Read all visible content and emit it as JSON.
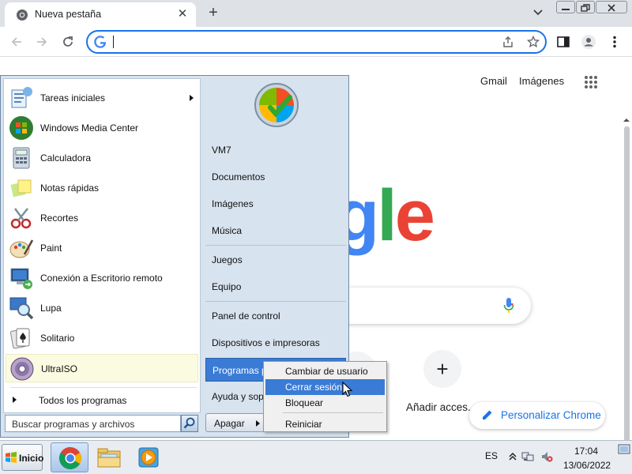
{
  "browser": {
    "tab_title": "Nueva pestaña",
    "tab_close": "✕",
    "new_tab": "+",
    "address_value": ""
  },
  "page": {
    "links": [
      "Gmail",
      "Imágenes"
    ],
    "logo_fragment": [
      "g",
      "l",
      "e"
    ],
    "shortcut_add_symbol": "+",
    "shortcut_add_label": "Añadir acces...",
    "customize_label": "Personalizar Chrome"
  },
  "start_menu": {
    "programs": [
      {
        "label": "Tareas iniciales",
        "icon": "getting-started-icon",
        "submenu": true
      },
      {
        "label": "Windows Media Center",
        "icon": "media-center-icon",
        "submenu": false
      },
      {
        "label": "Calculadora",
        "icon": "calculator-icon",
        "submenu": false
      },
      {
        "label": "Notas rápidas",
        "icon": "sticky-notes-icon",
        "submenu": false
      },
      {
        "label": "Recortes",
        "icon": "snipping-tool-icon",
        "submenu": false
      },
      {
        "label": "Paint",
        "icon": "paint-icon",
        "submenu": false
      },
      {
        "label": "Conexión a Escritorio remoto",
        "icon": "remote-desktop-icon",
        "submenu": false
      },
      {
        "label": "Lupa",
        "icon": "magnifier-icon",
        "submenu": false
      },
      {
        "label": "Solitario",
        "icon": "solitaire-icon",
        "submenu": false
      },
      {
        "label": "UltraISO",
        "icon": "ultraiso-icon",
        "submenu": false,
        "highlighted": true
      }
    ],
    "all_programs": "Todos los programas",
    "search_placeholder": "Buscar programas y archivos",
    "right_items": [
      "VM7",
      "Documentos",
      "Imágenes",
      "Música",
      "Juegos",
      "Equipo",
      "Panel de control",
      "Dispositivos e impresoras",
      "Programas predeterminados",
      "Ayuda y soporte técnico"
    ],
    "shutdown_label": "Apagar",
    "shutdown_submenu": [
      {
        "label": "Cambiar de usuario",
        "highlighted": false
      },
      {
        "label": "Cerrar sesión",
        "highlighted": true
      },
      {
        "label": "Bloquear",
        "highlighted": false
      },
      {
        "label": "Reiniciar",
        "highlighted": false
      }
    ]
  },
  "taskbar": {
    "start_label": "Inicio",
    "pinned": [
      "chrome-icon",
      "explorer-icon",
      "media-player-icon"
    ],
    "language": "ES",
    "time": "17:04",
    "date": "13/06/2022"
  },
  "colors": {
    "accent_blue": "#1a73e8",
    "menu_highlight": "#3a7bd5",
    "google_green": "#34a853",
    "google_red": "#ea4335",
    "google_blue": "#4285f4"
  }
}
